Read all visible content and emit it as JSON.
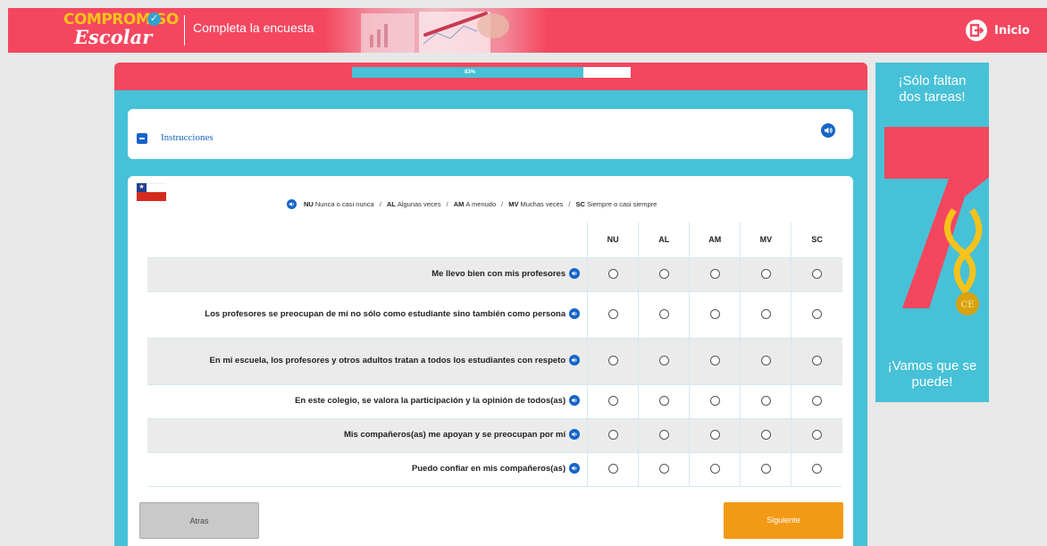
{
  "header": {
    "logo_top": "COMPROMISO",
    "logo_bottom": "Escolar",
    "title": "Completa la encuesta",
    "home_label": "Inicio"
  },
  "progress": {
    "value_percent": 83,
    "label": "83%"
  },
  "instructions": {
    "label": "Instrucciones"
  },
  "legend": [
    {
      "code": "NU",
      "text": "Nunca o casi nunca"
    },
    {
      "code": "AL",
      "text": "Algunas veces"
    },
    {
      "code": "AM",
      "text": "A menudo"
    },
    {
      "code": "MV",
      "text": "Muchas veces"
    },
    {
      "code": "SC",
      "text": "Siempre o casi siempre"
    }
  ],
  "options": [
    "NU",
    "AL",
    "AM",
    "MV",
    "SC"
  ],
  "questions": [
    "Me llevo bien con mis profesores",
    "Los profesores se preocupan de mí no sólo como estudiante sino también como persona",
    "En mi escuela, los profesores y otros adultos tratan a todos los estudiantes con respeto",
    "En este colegio, se valora la participación y la opinión de todos(as)",
    "Mis compañeros(as) me apoyan y se preocupan por mí",
    "Puedo confiar en mis compañeros(as)"
  ],
  "buttons": {
    "back": "Atras",
    "next": "Siguiente"
  },
  "side_banner": {
    "top_line1": "¡Sólo faltan",
    "top_line2": "dos tareas!",
    "bottom_line1": "¡Vamos que se",
    "bottom_line2": "puede!",
    "badge": "CE"
  },
  "colors": {
    "header_red": "#f4475f",
    "teal": "#47c1d7",
    "blue": "#1565c8",
    "orange": "#f29a16",
    "yellow": "#f7c21a"
  }
}
